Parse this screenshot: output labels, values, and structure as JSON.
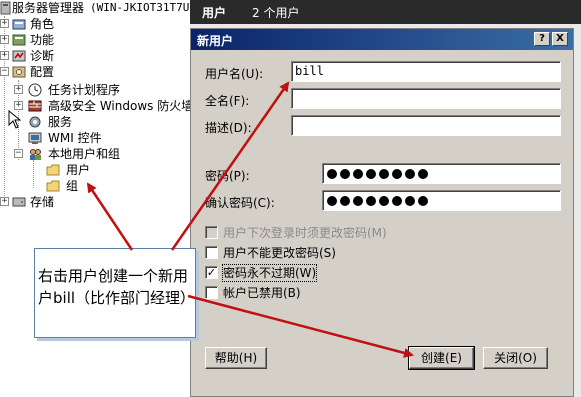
{
  "tree": {
    "root_label": "服务器管理器",
    "root_host": "(WIN-JKIOT31T7U",
    "items": [
      {
        "label": "角色",
        "icon": "roles-icon"
      },
      {
        "label": "功能",
        "icon": "features-icon"
      },
      {
        "label": "诊断",
        "icon": "diagnostics-icon"
      },
      {
        "label": "配置",
        "icon": "configuration-icon"
      },
      {
        "label": "任务计划程序",
        "icon": "clock-icon"
      },
      {
        "label": "高级安全 Windows 防火墙",
        "icon": "firewall-icon"
      },
      {
        "label": "服务",
        "icon": "gear-icon"
      },
      {
        "label": "WMI 控件",
        "icon": "wmi-icon"
      },
      {
        "label": "本地用户和组",
        "icon": "users-icon"
      },
      {
        "label": "用户",
        "icon": "folder-icon"
      },
      {
        "label": "组",
        "icon": "folder-icon"
      },
      {
        "label": "存储",
        "icon": "storage-icon"
      }
    ]
  },
  "header": {
    "title": "用户",
    "count": "2 个用户"
  },
  "dialog": {
    "title": "新用户",
    "help_btn": "?",
    "close_btn": "X",
    "username_label": "用户名(U):",
    "username_value": "bill",
    "fullname_label": "全名(F):",
    "fullname_value": "",
    "description_label": "描述(D):",
    "description_value": "",
    "password_label": "密码(P):",
    "confirm_label": "确认密码(C):",
    "password_dot_count": 8,
    "checkboxes": [
      {
        "label": "用户下次登录时须更改密码(M)",
        "checked": false,
        "enabled": false
      },
      {
        "label": "用户不能更改密码(S)",
        "checked": false,
        "enabled": true
      },
      {
        "label": "密码永不过期(W)",
        "checked": true,
        "enabled": true
      },
      {
        "label": "帐户已禁用(B)",
        "checked": false,
        "enabled": true
      }
    ],
    "help_button": "帮助(H)",
    "create_button": "创建(E)",
    "close_button": "关闭(O)"
  },
  "callout": {
    "text": "右击用户创建一个新用户bill（比作部门经理）"
  },
  "colors": {
    "arrow": "#c01010",
    "titlebar": "#0a246a",
    "dialog_bg": "#d4d0c8"
  }
}
